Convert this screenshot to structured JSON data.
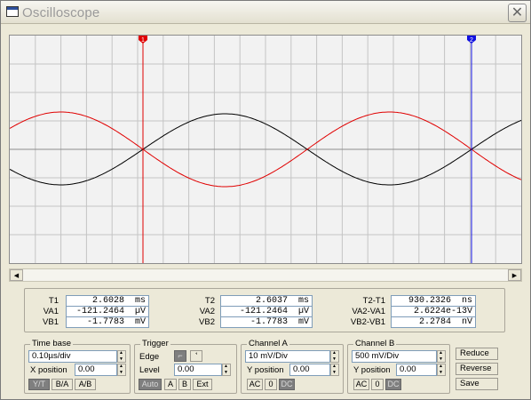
{
  "window": {
    "title": "Oscilloscope",
    "close_glyph": "✕"
  },
  "cursors": {
    "c1_label": "1",
    "c2_label": "2",
    "c1_color": "#e00000",
    "c2_color": "#1010e0"
  },
  "traces": {
    "channel_a_color": "#000000",
    "channel_b_color": "#e00000"
  },
  "readout": {
    "t1": {
      "label": "T1",
      "value": "2.6028  ms"
    },
    "va1": {
      "label": "VA1",
      "value": "-121.2464  µV"
    },
    "vb1": {
      "label": "VB1",
      "value": "-1.7783  mV"
    },
    "t2": {
      "label": "T2",
      "value": "2.6037  ms"
    },
    "va2": {
      "label": "VA2",
      "value": "-121.2464  µV"
    },
    "vb2": {
      "label": "VB2",
      "value": "-1.7783  mV"
    },
    "dt": {
      "label": "T2-T1",
      "value": "930.2326  ns"
    },
    "dva": {
      "label": "VA2-VA1",
      "value": "2.6224e-13V"
    },
    "dvb": {
      "label": "VB2-VB1",
      "value": "2.2784  nV"
    }
  },
  "timebase": {
    "title": "Time base",
    "value": "0.10µs/div",
    "xpos_label": "X position",
    "xpos_value": "0.00",
    "modes": [
      "Y/T",
      "B/A",
      "A/B"
    ]
  },
  "trigger": {
    "title": "Trigger",
    "edge_label": "Edge",
    "level_label": "Level",
    "level_value": "0.00",
    "rise_glyph": "⌐",
    "fall_glyph": "ꜗ",
    "sources": [
      "Auto",
      "A",
      "B",
      "Ext"
    ]
  },
  "channel_a": {
    "title": "Channel A",
    "value": "10 mV/Div",
    "ypos_label": "Y position",
    "ypos_value": "0.00",
    "coupling": [
      "AC",
      "0",
      "DC"
    ]
  },
  "channel_b": {
    "title": "Channel B",
    "value": "500 mV/Div",
    "ypos_label": "Y position",
    "ypos_value": "0.00",
    "coupling": [
      "AC",
      "0",
      "DC"
    ]
  },
  "actions": {
    "reduce": "Reduce",
    "reverse": "Reverse",
    "save": "Save"
  }
}
